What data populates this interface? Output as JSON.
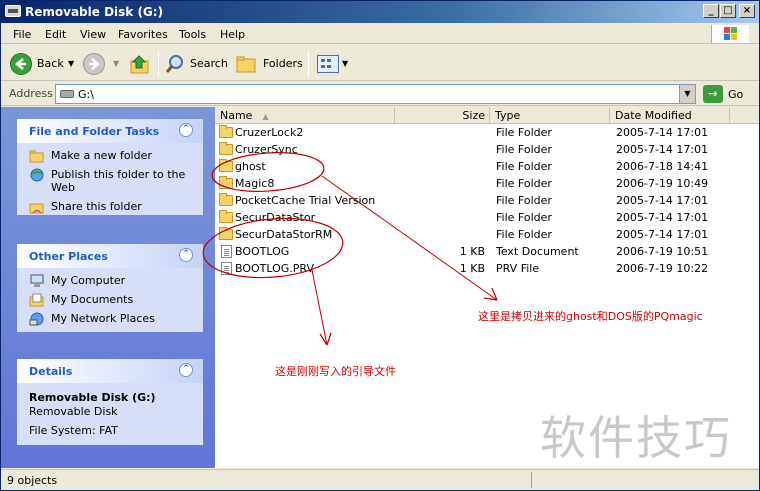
{
  "window": {
    "title": "Removable Disk (G:)"
  },
  "title_buttons": {
    "minimize": "_",
    "maximize": "□",
    "close": "×"
  },
  "menu": [
    "File",
    "Edit",
    "View",
    "Favorites",
    "Tools",
    "Help"
  ],
  "toolbar": {
    "back": "Back",
    "search": "Search",
    "folders": "Folders"
  },
  "address": {
    "label": "Address",
    "value": "G:\\",
    "go": "Go"
  },
  "left_pane": {
    "tasks": {
      "title": "File and Folder Tasks",
      "items": [
        "Make a new folder",
        "Publish this folder to the Web",
        "Share this folder"
      ]
    },
    "other_places": {
      "title": "Other Places",
      "items": [
        "My Computer",
        "My Documents",
        "My Network Places"
      ]
    },
    "details": {
      "title": "Details",
      "name": "Removable Disk (G:)",
      "type": "Removable Disk",
      "filesystem": "File System: FAT"
    }
  },
  "columns": {
    "name": "Name",
    "size": "Size",
    "type": "Type",
    "date": "Date Modified"
  },
  "files": [
    {
      "name": "CruzerLock2",
      "size": "",
      "type": "File Folder",
      "date": "2005-7-14 17:01",
      "kind": "folder"
    },
    {
      "name": "CruzerSync",
      "size": "",
      "type": "File Folder",
      "date": "2005-7-14 17:01",
      "kind": "folder"
    },
    {
      "name": "ghost",
      "size": "",
      "type": "File Folder",
      "date": "2006-7-18 14:41",
      "kind": "folder"
    },
    {
      "name": "Magic8",
      "size": "",
      "type": "File Folder",
      "date": "2006-7-19 10:49",
      "kind": "folder"
    },
    {
      "name": "PocketCache Trial Version",
      "size": "",
      "type": "File Folder",
      "date": "2005-7-14 17:01",
      "kind": "folder"
    },
    {
      "name": "SecurDataStor",
      "size": "",
      "type": "File Folder",
      "date": "2005-7-14 17:01",
      "kind": "folder"
    },
    {
      "name": "SecurDataStorRM",
      "size": "",
      "type": "File Folder",
      "date": "2005-7-14 17:01",
      "kind": "folder"
    },
    {
      "name": "BOOTLOG",
      "size": "1 KB",
      "type": "Text Document",
      "date": "2006-7-19 10:51",
      "kind": "doc"
    },
    {
      "name": "BOOTLOG.PRV",
      "size": "1 KB",
      "type": "PRV File",
      "date": "2006-7-19 10:22",
      "kind": "doc"
    }
  ],
  "annotations": {
    "copied_note": "这里是拷贝进来的ghost和DOS版的PQmagic",
    "boot_note": "这是刚刚写入的引导文件",
    "color": "#d40000"
  },
  "watermark": "软件技巧",
  "status": {
    "text": "9 objects"
  }
}
